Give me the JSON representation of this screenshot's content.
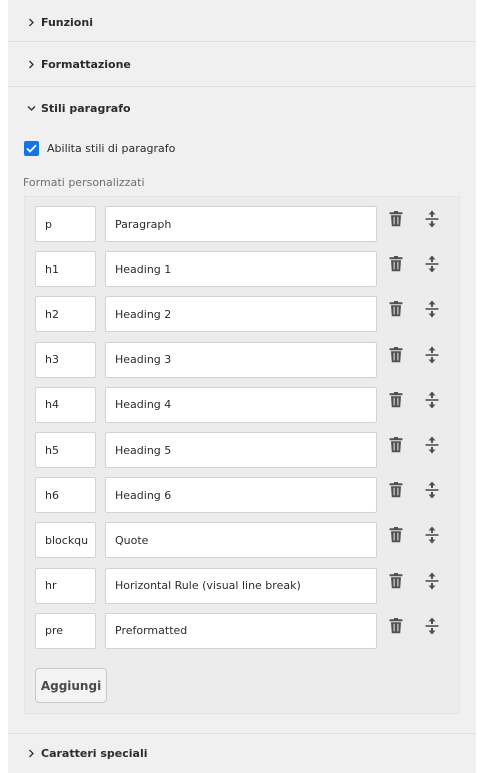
{
  "sections": {
    "functions": {
      "label": "Funzioni",
      "expanded": false
    },
    "formatting": {
      "label": "Formattazione",
      "expanded": false
    },
    "paragraph_styles": {
      "label": "Stili paragrafo",
      "expanded": true
    },
    "special_chars": {
      "label": "Caratteri speciali",
      "expanded": false
    }
  },
  "enable_paragraph_styles": {
    "label": "Abilita stili di paragrafo",
    "checked": true
  },
  "custom_formats": {
    "label": "Formati personalizzati",
    "rows": [
      {
        "tag": "p",
        "name": "Paragraph"
      },
      {
        "tag": "h1",
        "name": "Heading 1"
      },
      {
        "tag": "h2",
        "name": "Heading 2"
      },
      {
        "tag": "h3",
        "name": "Heading 3"
      },
      {
        "tag": "h4",
        "name": "Heading 4"
      },
      {
        "tag": "h5",
        "name": "Heading 5"
      },
      {
        "tag": "h6",
        "name": "Heading 6"
      },
      {
        "tag": "blockqu",
        "name": "Quote"
      },
      {
        "tag": "hr",
        "name": "Horizontal Rule (visual line break)"
      },
      {
        "tag": "pre",
        "name": "Preformatted"
      }
    ],
    "add_label": "Aggiungi"
  },
  "icons": {
    "collapsed": "chevron-right-icon",
    "expanded": "chevron-down-icon",
    "checkbox": "checkmark-icon",
    "delete": "trash-icon",
    "reorder": "move-vertical-icon"
  },
  "colors": {
    "panel_bg": "#f0f0f0",
    "accent": "#1473e6",
    "icon": "#505050",
    "text": "#2c2c2c",
    "muted_text": "#6e6e6e"
  }
}
